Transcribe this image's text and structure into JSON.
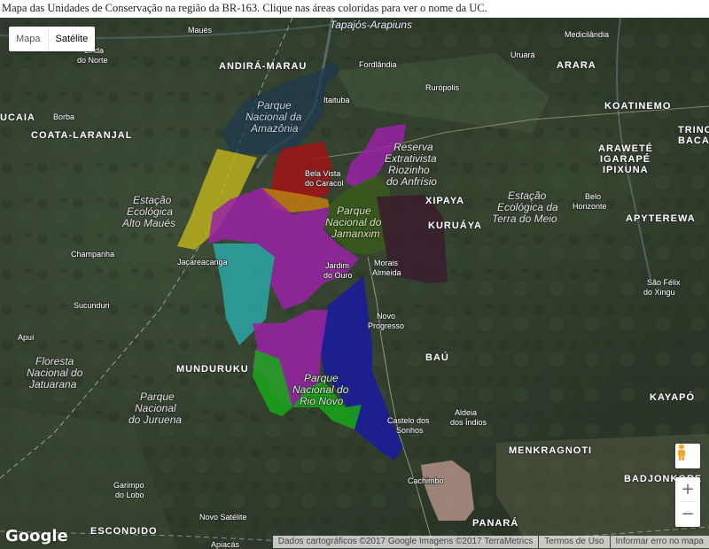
{
  "caption": "Mapa das Unidades de Conservação na região da BR-163. Clique nas áreas coloridas para ver o nome da UC.",
  "map_type": {
    "map_label": "Mapa",
    "satellite_label": "Satélite"
  },
  "zoom": {
    "in": "+",
    "out": "−"
  },
  "logo": "Google",
  "footer": {
    "data": "Dados cartográficos ©2017 Google Imagens ©2017 TerraMetrics",
    "terms": "Termos de Uso",
    "report": "Informar erro no mapa"
  },
  "colors": {
    "navy": "#1f3a4f",
    "red": "#a01414",
    "olive": "#c2b51a",
    "orange": "#c17a10",
    "purple": "#9a22a6",
    "teal": "#2ba6a6",
    "darkgreen": "#3a5a1a",
    "maroon": "#3a1f2e",
    "blue": "#1a1aa0",
    "green": "#18a818",
    "pink": "#b08f87"
  },
  "labels": {
    "andira": "ANDIRÁ-MARAU",
    "tapajos": "Tapajós-Arapiuns",
    "maues": "Maués",
    "fordlandia": "Fordlândia",
    "medicilandia": "Medicilândia",
    "uruara": "Uruará",
    "arara": "ARARA",
    "koatinemo": "KOATINEMO",
    "trinch": "TRINCH",
    "bacaja": "BACA",
    "lindalinda": "Linda",
    "donorte": "do Norte",
    "ucaia": "UCAIA",
    "borba": "Borba",
    "coata": "COATA-LARANJAL",
    "itaituba": "Itaituba",
    "ruropolis": "Rurópolis",
    "pn_amazonia_1": "Parque",
    "pn_amazonia_2": "Nacional da",
    "pn_amazonia_3": "Amazônia",
    "resex_1": "Reserva",
    "resex_2": "Extrativista",
    "resex_3": "Riozinho",
    "resex_4": "do Anfrísio",
    "belavista_1": "Bela Vista",
    "belavista_2": "do Caracol",
    "xipaya": "XIPAYA",
    "araweté": "ARAWETÉ",
    "igarape": "IGARAPÉ",
    "ipixuna": "IPIXUNA",
    "estmeio_1": "Estação",
    "estmeio_2": "Ecológica da",
    "estmeio_3": "Terra do Meio",
    "belo_1": "Belo",
    "belo_2": "Horizonte",
    "apyterewa": "APYTEREWA",
    "estalto_1": "Estação",
    "estalto_2": "Ecológica",
    "estalto_3": "Alto Maués",
    "jamanxim_1": "Parque",
    "jamanxim_2": "Nacional do",
    "jamanxim_3": "Jamanxim",
    "kuruaya": "KURUÁYA",
    "champanha": "Champanha",
    "jacareacanga": "Jacareacanga",
    "jardim_1": "Jardim",
    "jardim_2": "do Ouro",
    "morais_1": "Morais",
    "morais_2": "Almeida",
    "saofelix_1": "São Félix",
    "saofelix_2": "do Xingu",
    "sucunduri": "Sucunduri",
    "novoprog_1": "Novo",
    "novoprog_2": "Progresso",
    "apui": "Apuí",
    "flona_1": "Floresta",
    "flona_2": "Nacional do",
    "flona_3": "Jatuarana",
    "munduruku": "MUNDURUKU",
    "bau": "BAÚ",
    "rionovo_1": "Parque",
    "rionovo_2": "Nacional do",
    "rionovo_3": "Rio Novo",
    "kayapo": "KAYAPÓ",
    "juruena_1": "Parque",
    "juruena_2": "Nacional",
    "juruena_3": "do Juruena",
    "castelo_1": "Castelo dos",
    "castelo_2": "Sonhos",
    "aldeia_1": "Aldeia",
    "aldeia_2": "dos Índios",
    "menkragnoti": "MENKRAGNOTI",
    "cachimbo": "Cachimbo",
    "badjonkore": "BADJONKORE",
    "garimpo_1": "Garimpo",
    "garimpo_2": "do Lobo",
    "panara": "PANARÁ",
    "novosatelite": "Novo Satélite",
    "escondido": "ESCONDIDO",
    "apiacas": "Apiacás"
  }
}
